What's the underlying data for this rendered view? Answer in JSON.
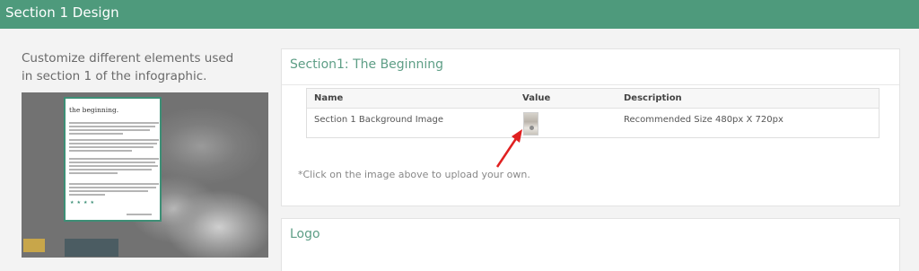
{
  "header": {
    "title": "Section 1 Design"
  },
  "left": {
    "description": "Customize different elements used in section 1 of the infographic.",
    "preview": {
      "panel_title": "the beginning."
    }
  },
  "section1_card": {
    "title": "Section1: The Beginning",
    "table": {
      "columns": [
        "Name",
        "Value",
        "Description"
      ],
      "rows": [
        {
          "name": "Section 1 Background Image",
          "value_icon": "image-thumbnail",
          "description": "Recommended Size 480px X 720px"
        }
      ]
    },
    "hint": "*Click on the image above to upload your own."
  },
  "logo_card": {
    "title": "Logo"
  },
  "colors": {
    "header": "#4e9a7c",
    "accent": "#5e9e86",
    "arrow": "#e02020"
  }
}
